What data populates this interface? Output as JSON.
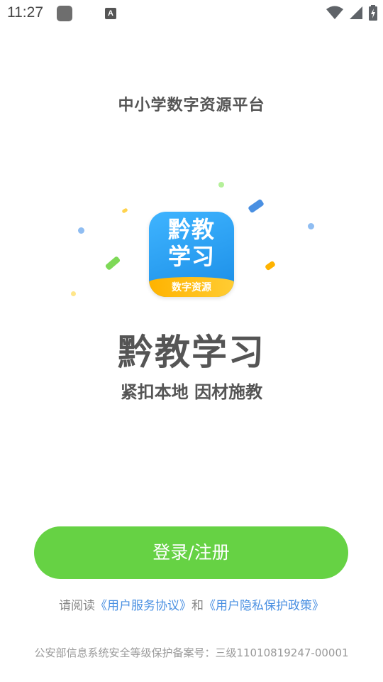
{
  "status_bar": {
    "time": "11:27",
    "notif_icon_letter": "A",
    "icons": [
      "wifi-icon",
      "signal-icon",
      "battery-charging-icon"
    ]
  },
  "header": {
    "platform_title": "中小学数字资源平台"
  },
  "logo": {
    "title_line1": "黔教",
    "title_line2": "学习",
    "band_text": "数字资源",
    "colors": {
      "top": "#3fb4ff",
      "bottom": "#1a8de6",
      "band": "#ffb300"
    }
  },
  "app": {
    "name": "黔教学习",
    "slogan": "紧扣本地 因材施教"
  },
  "actions": {
    "login_label": "登录/注册",
    "login_color": "#66d244"
  },
  "agreement": {
    "prefix": "请阅读",
    "user_agreement": "《用户服务协议》",
    "connector": "和",
    "privacy_policy": "《用户隐私保护政策》"
  },
  "footer": {
    "record_text": "公安部信息系统安全等级保护备案号：三级11010819247-00001"
  }
}
